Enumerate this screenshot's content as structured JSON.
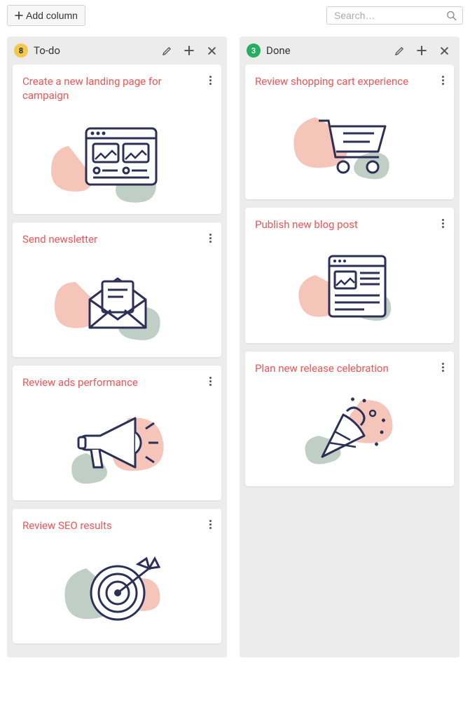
{
  "toolbar": {
    "add_column": "Add column",
    "search_placeholder": "Search…"
  },
  "columns": [
    {
      "id": "todo",
      "title": "To-do",
      "count": 8,
      "badge_color": "yellow",
      "cards": [
        {
          "title": "Create a new landing page for campaign",
          "icon": "browser"
        },
        {
          "title": "Send newsletter",
          "icon": "envelope"
        },
        {
          "title": "Review ads performance",
          "icon": "megaphone"
        },
        {
          "title": "Review SEO results",
          "icon": "target"
        }
      ]
    },
    {
      "id": "done",
      "title": "Done",
      "count": 3,
      "badge_color": "green",
      "cards": [
        {
          "title": "Review shopping cart experience",
          "icon": "cart"
        },
        {
          "title": "Publish new blog post",
          "icon": "document"
        },
        {
          "title": "Plan new release celebration",
          "icon": "celebrate"
        }
      ]
    }
  ],
  "colors": {
    "accent": "#eb5757",
    "line": "#2c2f56",
    "blob_pink": "#f6c5ba",
    "blob_sage": "#c0cfc5"
  }
}
